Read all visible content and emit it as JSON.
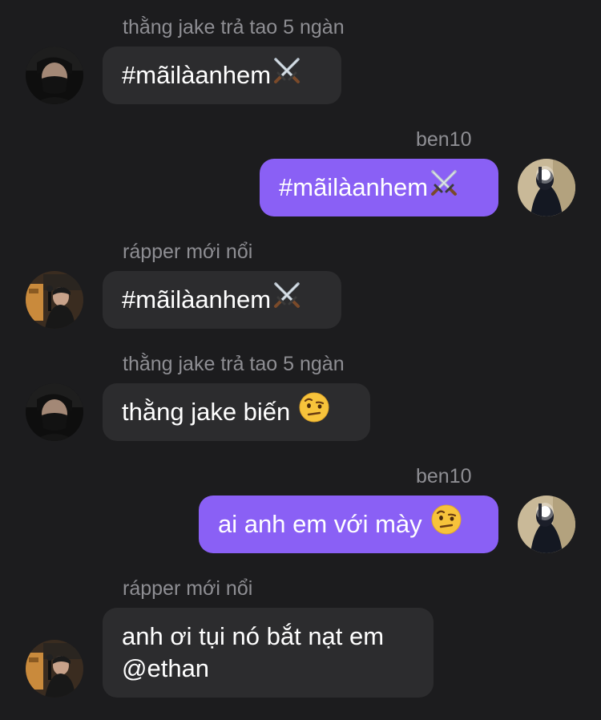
{
  "messages": [
    {
      "sender": "thằng jake trả tao 5 ngàn",
      "text": "#mãilàanhem",
      "emoji": "crossed-swords",
      "direction": "incoming"
    },
    {
      "sender": "ben10",
      "text": "#mãilàanhem",
      "emoji": "crossed-swords",
      "direction": "outgoing"
    },
    {
      "sender": "rápper mới nổi",
      "text": "#mãilàanhem",
      "emoji": "crossed-swords",
      "direction": "incoming"
    },
    {
      "sender": "thằng jake trả tao 5 ngàn",
      "text": "thằng jake biến",
      "emoji": "face-with-raised-eyebrow",
      "direction": "incoming"
    },
    {
      "sender": "ben10",
      "text": "ai anh em với mày",
      "emoji": "face-with-raised-eyebrow",
      "direction": "outgoing"
    },
    {
      "sender": "rápper mới nổi",
      "text_line1": "anh ơi tụi nó bắt nạt em",
      "text_line2": "@ethan",
      "direction": "incoming"
    }
  ],
  "colors": {
    "background": "#1c1c1e",
    "incoming_bubble": "#2c2c2e",
    "outgoing_bubble": "#8a60f5",
    "sender_name": "#8e8e93"
  }
}
